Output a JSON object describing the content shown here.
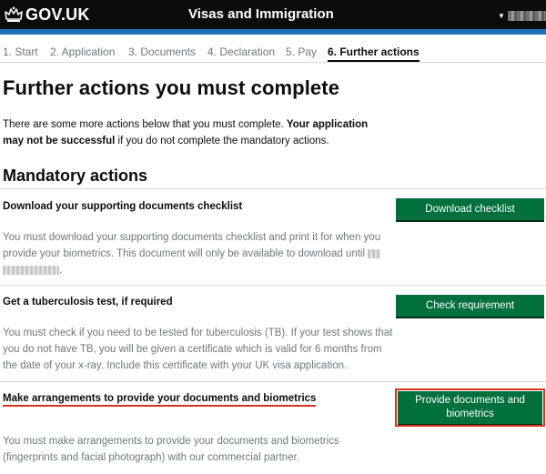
{
  "header": {
    "logo_text": "GOV.UK",
    "service_name": "Visas and Immigration",
    "colors": {
      "bar": "#0b0c0c",
      "accent": "#1d70b8"
    }
  },
  "steps": [
    {
      "label": "1. Start",
      "active": false
    },
    {
      "label": "2. Application",
      "active": false
    },
    {
      "label": "3. Documents",
      "active": false
    },
    {
      "label": "4. Declaration",
      "active": false
    },
    {
      "label": "5. Pay",
      "active": false
    },
    {
      "label": "6. Further actions",
      "active": true
    }
  ],
  "page": {
    "title": "Further actions you must complete",
    "intro_plain": "There are some more actions below that you must complete. ",
    "intro_bold_1": "Your application may not be successful",
    "intro_rest": " if you do not complete the mandatory actions.",
    "section_heading": "Mandatory actions"
  },
  "tasks": [
    {
      "title": "Download your supporting documents checklist",
      "description": "You must download your supporting documents checklist and print it for when you provide your biometrics. This document will only be available to download until",
      "button": "Download checklist"
    },
    {
      "title": "Get a tuberculosis test, if required",
      "description": "You must check if you need to be tested for tuberculosis (TB). If your test shows that you do not have TB, you will be given a certificate which is valid for 6 months from the date of your x-ray. Include this certificate with your UK visa application.",
      "button": "Check requirement"
    },
    {
      "title": "Make arrangements to provide your documents and biometrics",
      "description": "You must make arrangements to provide your documents and biometrics (fingerprints and facial photograph) with our commercial partner.",
      "button": "Provide documents and biometrics"
    }
  ],
  "colors": {
    "button": "#00703c",
    "focus": "#d4351c",
    "muted_text": "#6f777b"
  }
}
